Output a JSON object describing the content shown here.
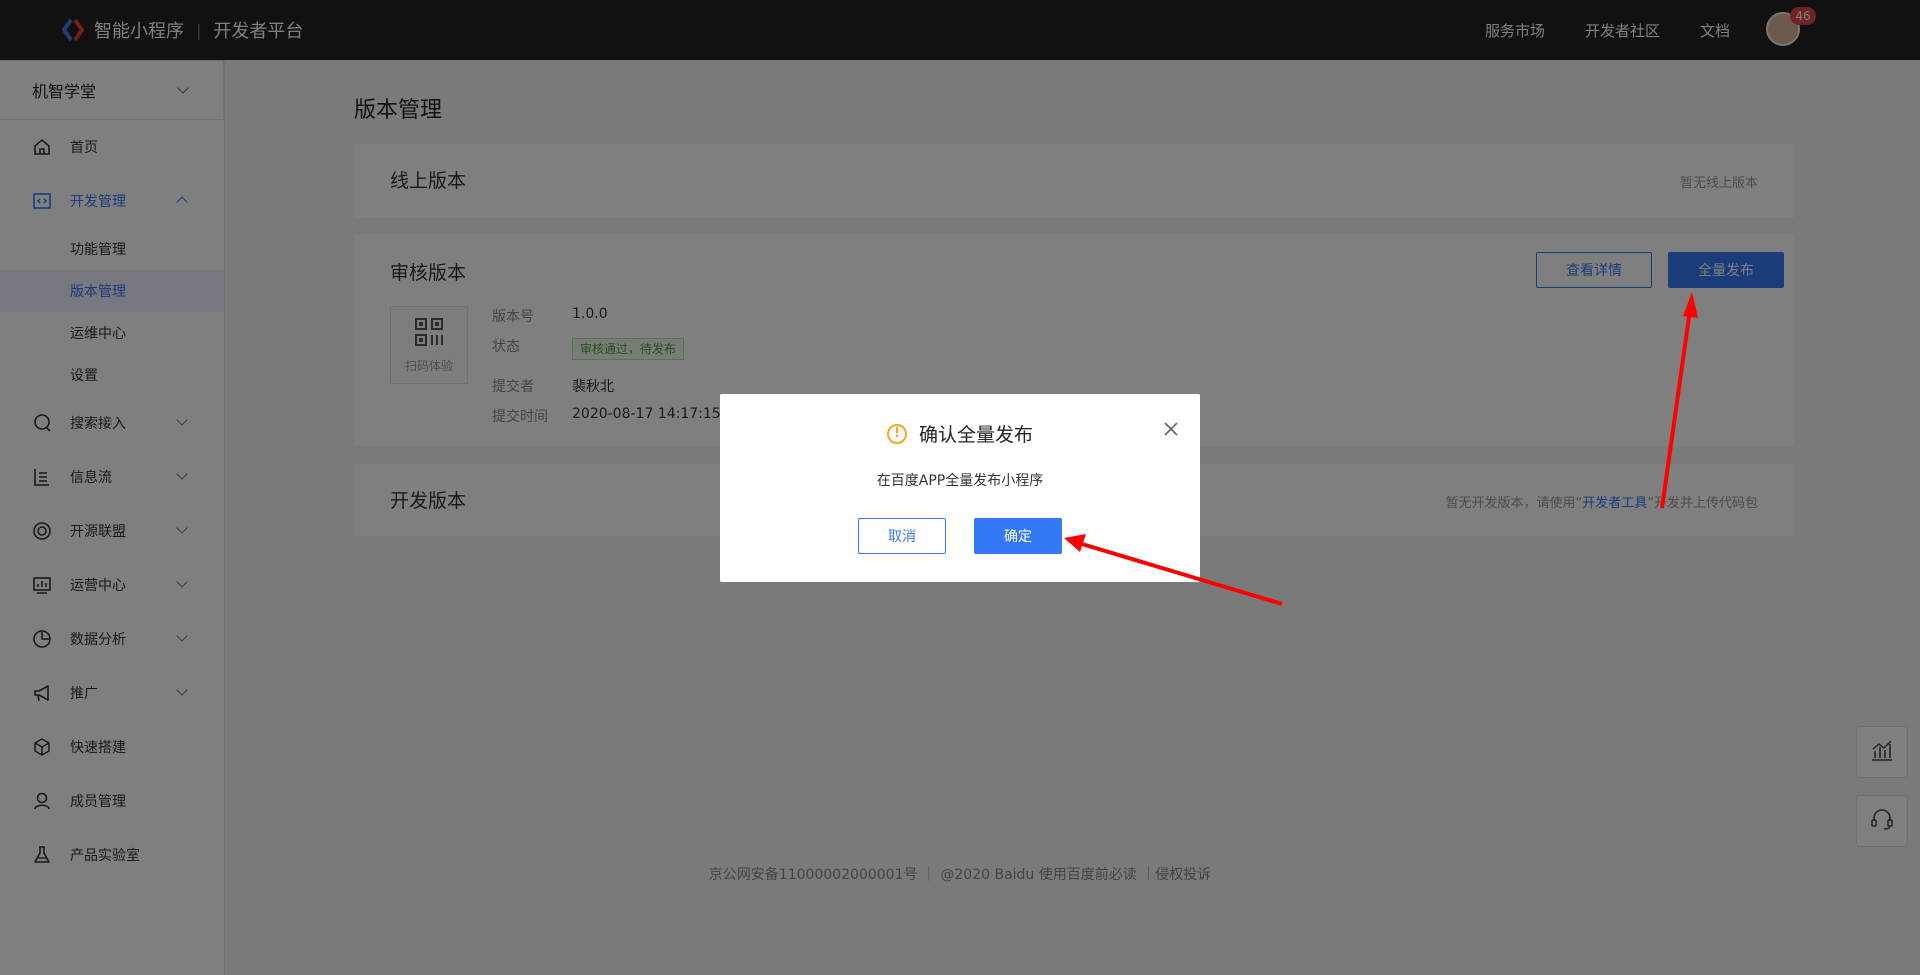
{
  "header": {
    "brand": "智能小程序",
    "platform": "开发者平台",
    "nav": [
      "服务市场",
      "开发者社区",
      "文档"
    ],
    "notification_count": "46"
  },
  "sidebar": {
    "app_name": "机智学堂",
    "items": [
      {
        "label": "首页",
        "icon": "home-icon"
      },
      {
        "label": "开发管理",
        "icon": "code-icon"
      },
      {
        "label": "搜索接入",
        "icon": "search-icon"
      },
      {
        "label": "信息流",
        "icon": "feed-icon"
      },
      {
        "label": "开源联盟",
        "icon": "alliance-icon"
      },
      {
        "label": "运营中心",
        "icon": "operations-icon"
      },
      {
        "label": "数据分析",
        "icon": "pie-chart-icon"
      },
      {
        "label": "推广",
        "icon": "megaphone-icon"
      },
      {
        "label": "快速搭建",
        "icon": "cube-icon"
      },
      {
        "label": "成员管理",
        "icon": "user-icon"
      },
      {
        "label": "产品实验室",
        "icon": "flask-icon"
      }
    ],
    "dev_sub": [
      "功能管理",
      "版本管理",
      "运维中心",
      "设置"
    ]
  },
  "main": {
    "title": "版本管理",
    "online": {
      "title": "线上版本",
      "empty_text": "暂无线上版本"
    },
    "review": {
      "title": "审核版本",
      "details_button": "查看详情",
      "publish_button": "全量发布",
      "qr_label": "扫码体验",
      "version_label": "版本号",
      "version_value": "1.0.0",
      "status_label": "状态",
      "status_value": "审核通过，待发布",
      "submitter_label": "提交者",
      "submitter_value": "裴秋北",
      "submit_time_label": "提交时间",
      "submit_time_value": "2020-08-17 14:17:15"
    },
    "dev": {
      "title": "开发版本",
      "empty_prefix": "暂无开发版本，请使用“",
      "tool_link": "开发者工具",
      "empty_suffix": "”开发并上传代码包"
    }
  },
  "footer": {
    "text": "京公网安备11000002000001号 ｜ @2020 Baidu 使用百度前必读 ｜侵权投诉"
  },
  "modal": {
    "title": "确认全量发布",
    "message": "在百度APP全量发布小程序",
    "cancel": "取消",
    "confirm": "确定"
  },
  "colors": {
    "accent": "#3478f6",
    "warning": "#f5a623",
    "annotation": "#ff0000"
  }
}
